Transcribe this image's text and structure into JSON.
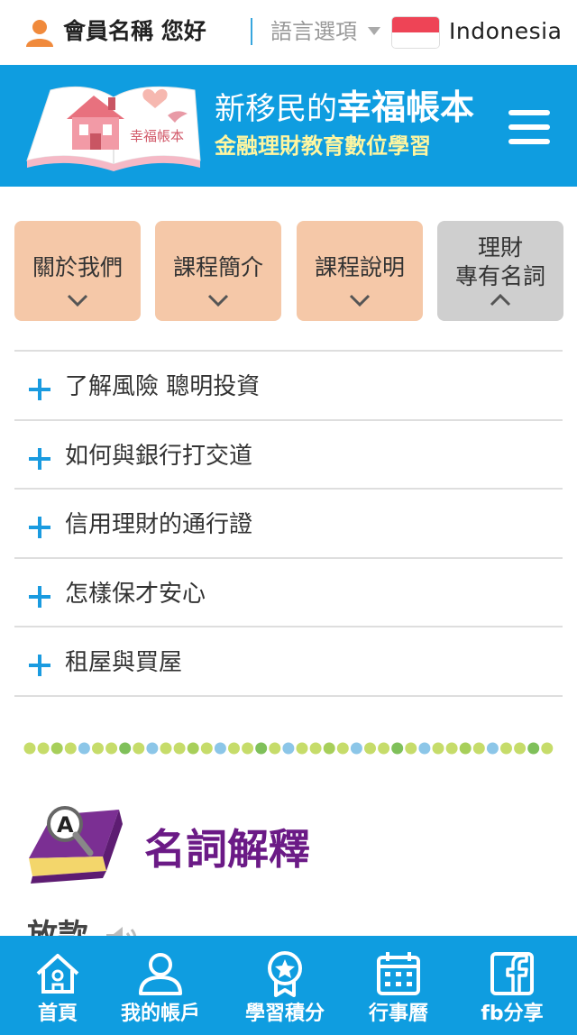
{
  "topbar": {
    "greeting": "會員名稱 您好",
    "language_label": "語言選項",
    "language_selected": "Indonesia"
  },
  "header": {
    "logo_text": "幸福帳本",
    "title_prefix": "新移民的",
    "title_main": "幸福帳本",
    "subtitle": "金融理財教育數位學習"
  },
  "tabs": [
    {
      "label": "關於我們",
      "active": false
    },
    {
      "label": "課程簡介",
      "active": false
    },
    {
      "label": "課程說明",
      "active": false
    },
    {
      "label": "理財\n專有名詞",
      "active": true
    }
  ],
  "accordion": [
    {
      "label": "了解風險 聰明投資"
    },
    {
      "label": "如何與銀行打交道"
    },
    {
      "label": "信用理財的通行證"
    },
    {
      "label": "怎樣保才安心"
    },
    {
      "label": "租屋與買屋"
    }
  ],
  "glossary": {
    "icon_letter": "A",
    "title": "名詞解釋",
    "first_term_partial": "放款"
  },
  "bottom_nav": [
    {
      "label": "首頁",
      "icon": "home-icon"
    },
    {
      "label": "我的帳戶",
      "icon": "user-account-icon"
    },
    {
      "label": "學習積分",
      "icon": "medal-icon"
    },
    {
      "label": "行事曆",
      "icon": "calendar-icon"
    },
    {
      "label": "fb分享",
      "icon": "facebook-icon"
    }
  ],
  "colors": {
    "primary_blue": "#0f9de0",
    "tab_orange": "#f5c8a8",
    "tab_active_gray": "#cfcfcf",
    "glossary_purple": "#6b1a86",
    "accent_yellow": "#fff6a0"
  }
}
